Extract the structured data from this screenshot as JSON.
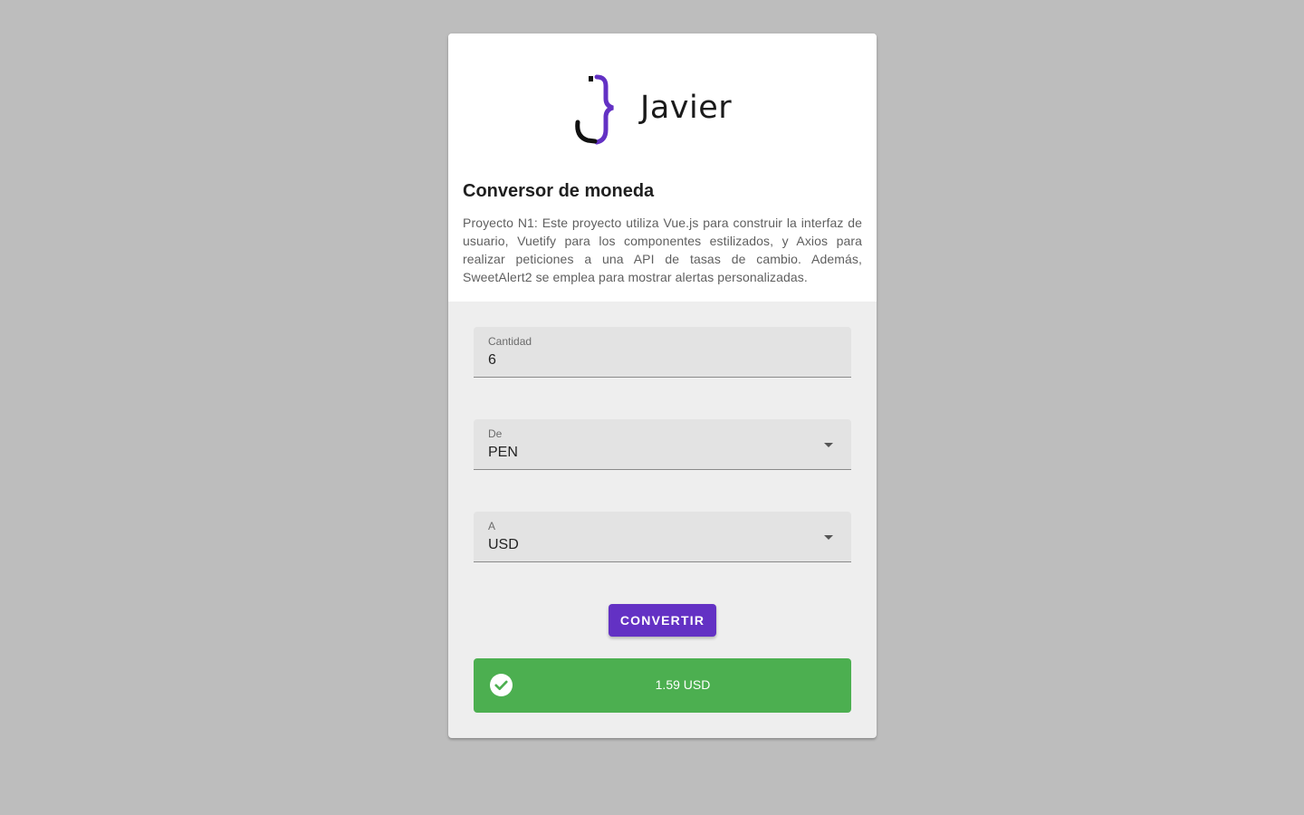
{
  "brand": {
    "logo_text": "Javier",
    "accent_color": "#6331c4"
  },
  "header": {
    "title": "Conversor de moneda",
    "description": "Proyecto N1: Este proyecto utiliza Vue.js para construir la interfaz de usuario, Vuetify para los componentes estilizados, y Axios para realizar peticiones a una API de tasas de cambio. Además, SweetAlert2 se emplea para mostrar alertas personalizadas."
  },
  "form": {
    "amount": {
      "label": "Cantidad",
      "value": "6"
    },
    "from": {
      "label": "De",
      "value": "PEN"
    },
    "to": {
      "label": "A",
      "value": "USD"
    },
    "convert_label": "CONVERTIR"
  },
  "result": {
    "text": "1.59 USD",
    "status_color": "#4caf50",
    "icon": "check-circle-icon"
  }
}
